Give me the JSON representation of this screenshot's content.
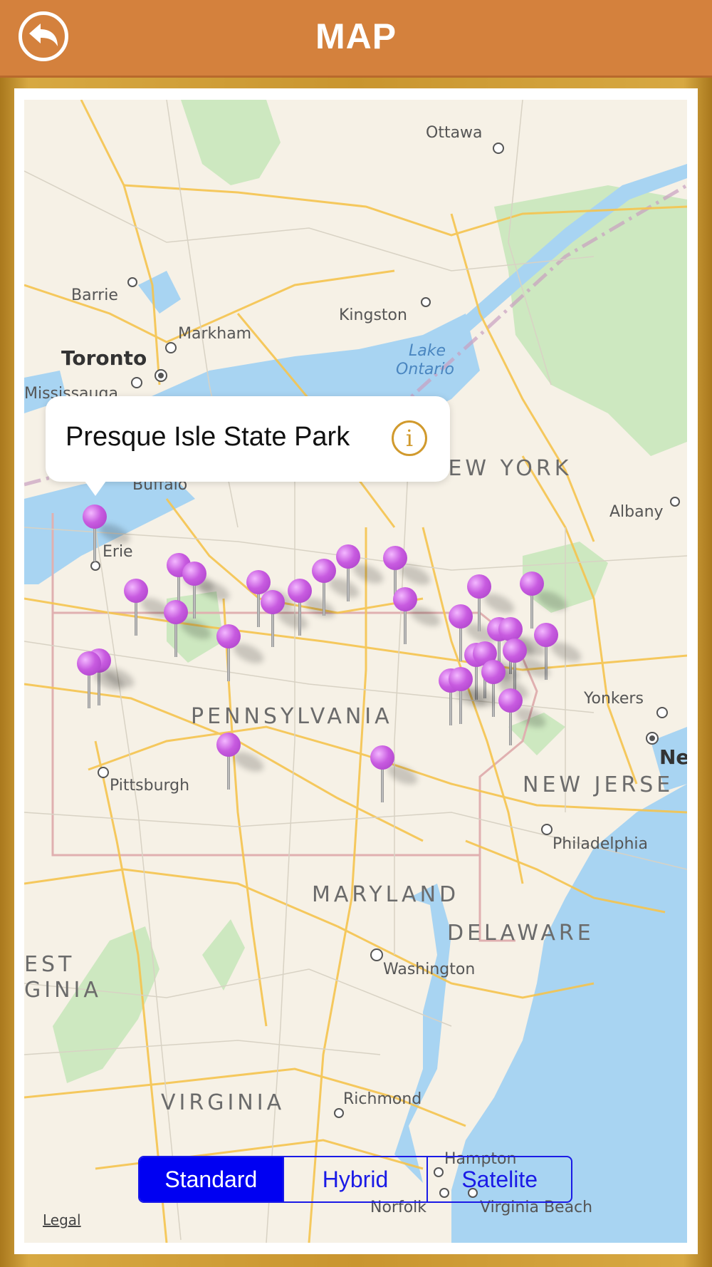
{
  "header": {
    "title": "MAP",
    "back_icon": "back-arrow-icon"
  },
  "callout": {
    "title": "Presque Isle State Park",
    "info_icon": "info-icon",
    "info_glyph": "i"
  },
  "labels": {
    "ottawa": "Ottawa",
    "barrie": "Barrie",
    "kingston": "Kingston",
    "markham": "Markham",
    "toronto": "Toronto",
    "mississauga": "Mississauga",
    "lake_ontario_1": "Lake",
    "lake_ontario_2": "Ontario",
    "buffalo": "Buffalo",
    "new_york": "NEW YORK",
    "albany": "Albany",
    "erie": "Erie",
    "yonkers": "Yonkers",
    "new_york_city": "Ne",
    "pennsylvania": "PENNSYLVANIA",
    "pittsburgh": "Pittsburgh",
    "new_jersey": "NEW JERSE",
    "philadelphia": "Philadelphia",
    "maryland": "MARYLAND",
    "delaware": "DELAWARE",
    "washington": "Washington",
    "west_virginia_1": "EST",
    "west_virginia_2": "GINIA",
    "virginia": "VIRGINIA",
    "richmond": "Richmond",
    "hampton": "Hampton",
    "norfolk": "Norfolk",
    "virginia_beach": "Virginia Beach"
  },
  "map_type": {
    "options": [
      "Standard",
      "Hybrid",
      "Satelite"
    ],
    "selected": "Standard"
  },
  "legal": "Legal",
  "colors": {
    "header": "#d4813d",
    "frame": "#c9952f",
    "pin": "#c85be0",
    "water": "#a8d4f2",
    "segment": "#0000f2"
  }
}
